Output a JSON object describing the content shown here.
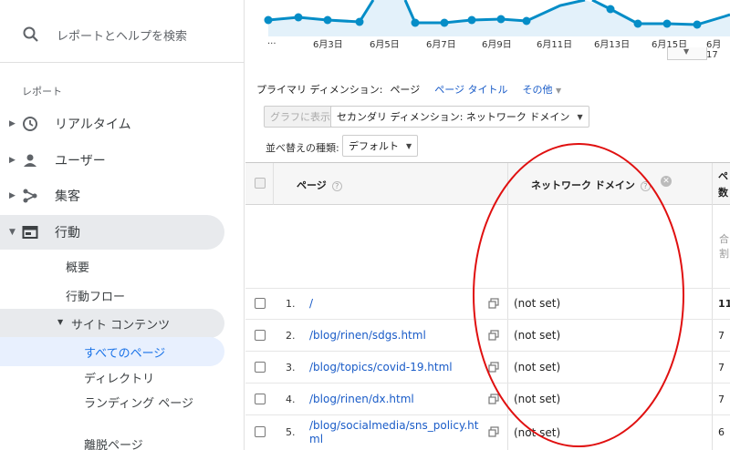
{
  "sidebar": {
    "search_placeholder": "レポートとヘルプを検索",
    "section_label": "レポート",
    "items": [
      {
        "label": "リアルタイム",
        "icon": "clock-icon"
      },
      {
        "label": "ユーザー",
        "icon": "person-icon"
      },
      {
        "label": "集客",
        "icon": "acquisition-icon"
      },
      {
        "label": "行動",
        "icon": "behavior-icon"
      }
    ],
    "behavior_sub": {
      "overview": "概要",
      "flow": "行動フロー",
      "site_content": "サイト コンテンツ",
      "all_pages": "すべてのページ",
      "directory": "ディレクトリ",
      "landing_pages": "ランディング ページ",
      "exit_pages": "離脱ページ"
    }
  },
  "chart": {
    "x_labels": [
      "...",
      "6月3日",
      "6月5日",
      "6月7日",
      "6月9日",
      "6月11日",
      "6月13日",
      "6月15日",
      "6月17"
    ],
    "line_color": "#058dc7"
  },
  "dimension_bar": {
    "primary_label": "プライマリ ディメンション:",
    "primary_current": "ページ",
    "page_title_link": "ページ タイトル",
    "other_link": "その他"
  },
  "toolbar": {
    "graph_button": "グラフに表示",
    "secondary_dim": "セカンダリ ディメンション: ネットワーク ドメイン",
    "sort_label": "並べ替えの種類:",
    "sort_value": "デフォルト"
  },
  "table": {
    "col_page": "ページ",
    "col_domain": "ネットワーク ドメイン",
    "col_metric_line1": "ペ",
    "col_metric_line2": "数",
    "summary_line1": "合",
    "summary_line2": "割",
    "rows": [
      {
        "num": "1.",
        "page": "/",
        "domain": "(not set)",
        "value": "11"
      },
      {
        "num": "2.",
        "page": "/blog/rinen/sdgs.html",
        "domain": "(not set)",
        "value": "7"
      },
      {
        "num": "3.",
        "page": "/blog/topics/covid-19.html",
        "domain": "(not set)",
        "value": "7"
      },
      {
        "num": "4.",
        "page": "/blog/rinen/dx.html",
        "domain": "(not set)",
        "value": "7"
      },
      {
        "num": "5.",
        "page": "/blog/socialmedia/sns_policy.ht\nml",
        "domain": "(not set)",
        "value": "6"
      }
    ]
  },
  "annotation_color": "#e01010"
}
